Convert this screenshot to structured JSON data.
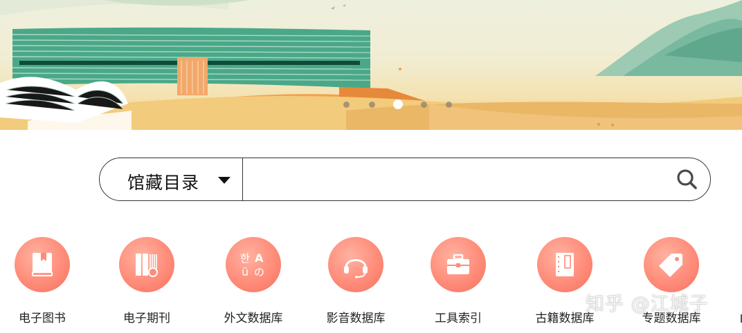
{
  "search": {
    "type_label": "馆藏目录",
    "placeholder": ""
  },
  "banner": {
    "slide_count": 5,
    "active_slide": 3
  },
  "categories": [
    {
      "label": "电子图书",
      "icon": "ebook-icon"
    },
    {
      "label": "电子期刊",
      "icon": "journal-icon"
    },
    {
      "label": "外文数据库",
      "icon": "foreign-language-icon"
    },
    {
      "label": "影音数据库",
      "icon": "headphones-icon"
    },
    {
      "label": "工具索引",
      "icon": "toolbox-icon"
    },
    {
      "label": "古籍数据库",
      "icon": "ancient-book-icon"
    },
    {
      "label": "专题数据库",
      "icon": "tag-icon"
    }
  ],
  "watermark": "知乎 @江城子",
  "colors": {
    "accent": "#ff8c7a",
    "banner_gold": "#efc278",
    "banner_green": "#3aa486"
  }
}
